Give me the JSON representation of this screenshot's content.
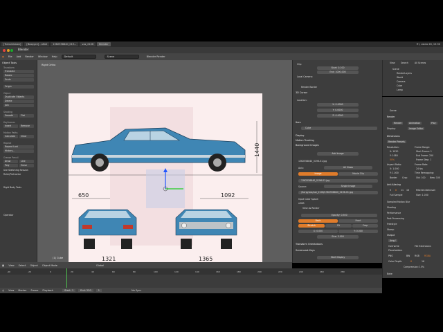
{
  "taskbar": {
    "items": [
      "[Transmission]",
      "[Вкорусе] - afedi",
      "1362558840_019...",
      "vaz_2106",
      "Blender"
    ],
    "clock": "Пт, июня 28, 15:30"
  },
  "window": {
    "title": "Blender"
  },
  "menubar": {
    "items": [
      "File",
      "Add",
      "Render",
      "Window",
      "Help"
    ],
    "layout": "Default",
    "scene": "Scene",
    "engine": "Blender Render"
  },
  "toolshelf": {
    "title": "Object Tools",
    "transform_head": "Transform",
    "transform": [
      "Translate",
      "Rotate",
      "Scale",
      "Origin"
    ],
    "object_head": "Object",
    "object": [
      "Duplicate Objects",
      "Delete",
      "Join"
    ],
    "shading_head": "Shading",
    "smooth": "Smooth",
    "flat": "Flat",
    "keyframes_head": "Keyframes",
    "insert": "Insert",
    "remove": "Remove",
    "motion_head": "Motion Paths",
    "calculate": "Calculate",
    "clear": "Clear",
    "repeat_head": "Repeat",
    "repeat_last": "Repeat Last",
    "history": "History...",
    "grease_head": "Grease Pencil",
    "draw": "Draw",
    "line": "Line",
    "poly": "Poly",
    "erase": "Erase",
    "use_sketching": "Use Sketching Session",
    "ruler": "Ruler/Protractor",
    "rigid_head": "Rigid Body Tools",
    "operator": "Operator"
  },
  "viewport": {
    "label": "Right Ortho",
    "footer": "(1) Cube",
    "dimensions": [
      "650",
      "1092",
      "1440",
      "1321",
      "1365"
    ]
  },
  "viewport_header": {
    "items": [
      "View",
      "Select",
      "Object",
      "Object Mode",
      "Global"
    ]
  },
  "npanel": {
    "clip": "Clip:",
    "start": "Start: 0.100",
    "end": "End: 1000.000",
    "local_camera": "Local Camera:",
    "render_border": "Render Border",
    "cursor_head": "3D Cursor",
    "location": "Location:",
    "x": "X: 0.0000",
    "y": "Y: 0.0000",
    "z": "Z: 0.0000",
    "item_head": "Item",
    "item_name": "Cube",
    "display_head": "Display",
    "motion_tracking": "Motion Tracking",
    "bg_images": "Background Images",
    "add_image": "Add Image",
    "image_file": "1362558840_0196-01.jpg",
    "axis": "Axis:",
    "axis_value": "All Views",
    "image_btn": "Image",
    "movie_clip_btn": "Movie Clip",
    "image_file2": "1362558840_0196-01.jpg",
    "source": "Source:",
    "source_value": "Single Image",
    "filepath": "/Загрузки/vaz_2106/1362558840_0196-01.jpg",
    "input_color": "Input Color Space:",
    "srgb": "sRGB",
    "view_as_render": "View as Render",
    "opacity": "Opacity: 0.500",
    "back": "Back",
    "front": "Front",
    "stretch": "Stretch",
    "fit": "Fit",
    "crop": "Crop",
    "x2": "X: 0.000",
    "y2": "Y: 0.000",
    "size": "Size: 5.000",
    "transform_orient": "Transform Orientations",
    "screencast_keys": "Screencast Keys",
    "start_display": "Start Display"
  },
  "outliner": {
    "view": "View",
    "search": "Search",
    "all_scenes": "All Scenes",
    "items": [
      "Scene",
      "RenderLayers",
      "World",
      "Camera",
      "Cube",
      "Lamp"
    ]
  },
  "properties": {
    "scene": "Scene",
    "render_head": "Render",
    "render": "Render",
    "animation": "Animation",
    "play": "Play",
    "display": "Display:",
    "display_value": "Image Editor",
    "dimensions_head": "Dimensions",
    "render_presets": "Render Presets",
    "resolution": "Resolution:",
    "res_x": "X: 1920",
    "res_y": "Y: 1080",
    "res_pct": "50%",
    "frame_range": "Frame Range:",
    "start_frame": "Start Frame: 1",
    "end_frame": "End Frame: 250",
    "frame_step": "Frame Step: 1",
    "aspect_ratio": "Aspect Ratio:",
    "asp_x": "X: 1.000",
    "asp_y": "Y: 1.000",
    "frame_rate": "Frame Rate:",
    "fps": "24 fps",
    "time_remap": "Time Remapping:",
    "border": "Border",
    "crop": "Crop",
    "old": "Old: 100",
    "new": "New: 100",
    "aa_head": "Anti-Aliasing",
    "aa_vals": [
      "5",
      "8",
      "11",
      "16"
    ],
    "filter": "Mitchell-Netravali",
    "full_sample": "Full Sample",
    "aa_size": "Size: 1.000",
    "sampled_motion": "Sampled Motion Blur",
    "shading": "Shading",
    "performance": "Performance",
    "post_processing": "Post Processing",
    "freestyle": "Freestyle",
    "stamp": "Stamp",
    "output": "Output",
    "tmp": "/tmp/",
    "overwrite": "Overwrite",
    "file_extensions": "File Extensions",
    "placeholders": "Placeholders",
    "png": "PNG",
    "bw": "BW",
    "rgb": "RGB",
    "rgba": "RGBA",
    "color_depth": "Color Depth:",
    "depth8": "8",
    "depth16": "16",
    "compression": "Compression: 15%",
    "bake": "Bake"
  },
  "timeline": {
    "ruler": [
      "-40",
      "-20",
      "0",
      "20",
      "40",
      "60",
      "80",
      "100",
      "120",
      "140",
      "160",
      "180",
      "200",
      "220",
      "240",
      "260",
      "280"
    ],
    "header": [
      "View",
      "Marker",
      "Frame",
      "Playback"
    ],
    "start": "Start: 1",
    "end": "End: 250",
    "current": "1",
    "no_sync": "No Sync"
  },
  "colors": {
    "car_blue": "#3f86b4",
    "accent": "#e07c2b",
    "panel": "#3d3d3d",
    "viewport": "#5e5e5e"
  }
}
